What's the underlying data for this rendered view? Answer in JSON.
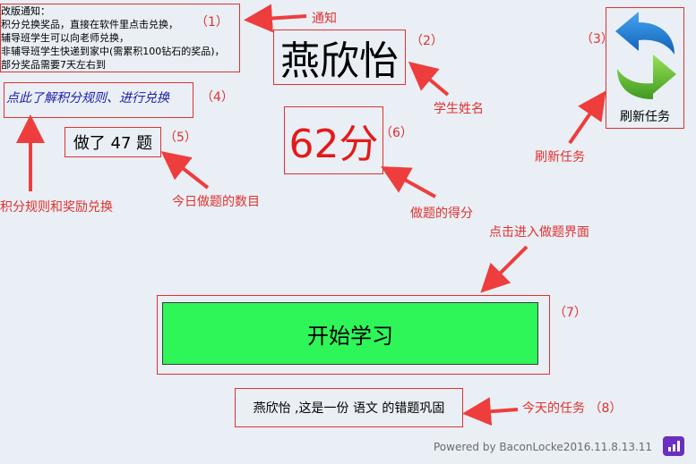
{
  "notice": {
    "lines": [
      "改版通知：",
      "积分兑换奖品，直接在软件里点击兑换，",
      "辅导班学生可以向老师兑换，",
      "非辅导班学生快递到家中(需累积100钻石的奖品)，",
      "部分奖品需要7天左右到"
    ]
  },
  "student_name": "燕欣怡",
  "refresh_button": {
    "label": "刷新任务"
  },
  "rules_link": "点此了解积分规则、进行兑换",
  "question_count": "做了 47 题",
  "score": "62分",
  "start_button": "开始学习",
  "task_text": "燕欣怡 ,这是一份 语文 的错题巩固",
  "footer": "Powered by BaconLocke2016.11.8.13.11",
  "annotations": {
    "n1": "（1）",
    "notice_label": "通知",
    "n2": "（2）",
    "name_label": "学生姓名",
    "n3": "（3）",
    "refresh_label": "刷新任务",
    "n4": "（4）",
    "rules_label": "积分规则和奖励兑换",
    "n5": "（5）",
    "count_label": "今日做题的数目",
    "n6": "（6）",
    "score_label": "做题的得分",
    "enter_label": "点击进入做题界面",
    "n7": "（7）",
    "task_label": "今天的任务 （8）"
  },
  "colors": {
    "annotation": "#e0312f",
    "score": "#e31a1a",
    "start_button": "#2ef658",
    "link": "#1a1aa6"
  }
}
